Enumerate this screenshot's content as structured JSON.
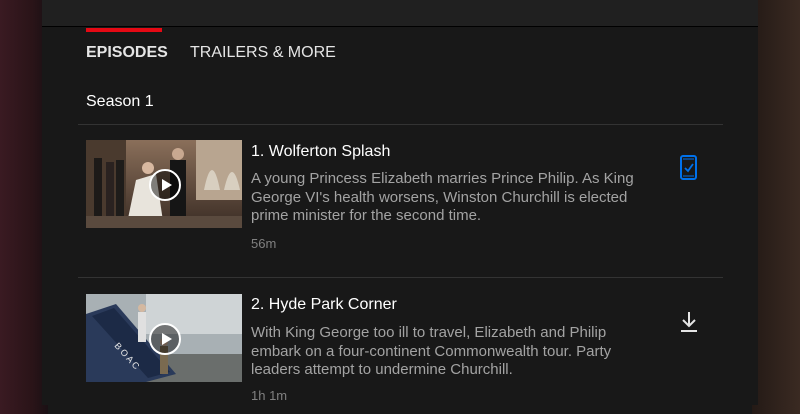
{
  "tabs": [
    {
      "label": "EPISODES",
      "active": true
    },
    {
      "label": "TRAILERS & MORE",
      "active": false
    }
  ],
  "season_label": "Season 1",
  "episodes": [
    {
      "title": "1. Wolferton Splash",
      "description": "A young Princess Elizabeth marries Prince Philip. As King George VI's health worsens, Winston Churchill is elected prime minister for the second time.",
      "duration": "56m",
      "action_icon": "downloaded-check-icon",
      "action_color": "#0071eb"
    },
    {
      "title": "2. Hyde Park Corner",
      "description": "With King George too ill to travel, Elizabeth and Philip embark on a four-continent Commonwealth tour. Party leaders attempt to undermine Churchill.",
      "duration": "1h 1m",
      "action_icon": "download-icon",
      "action_color": "#e5e5e5"
    }
  ],
  "colors": {
    "accent": "#e50914",
    "background": "#181818",
    "muted_text": "#a3a3a3"
  }
}
